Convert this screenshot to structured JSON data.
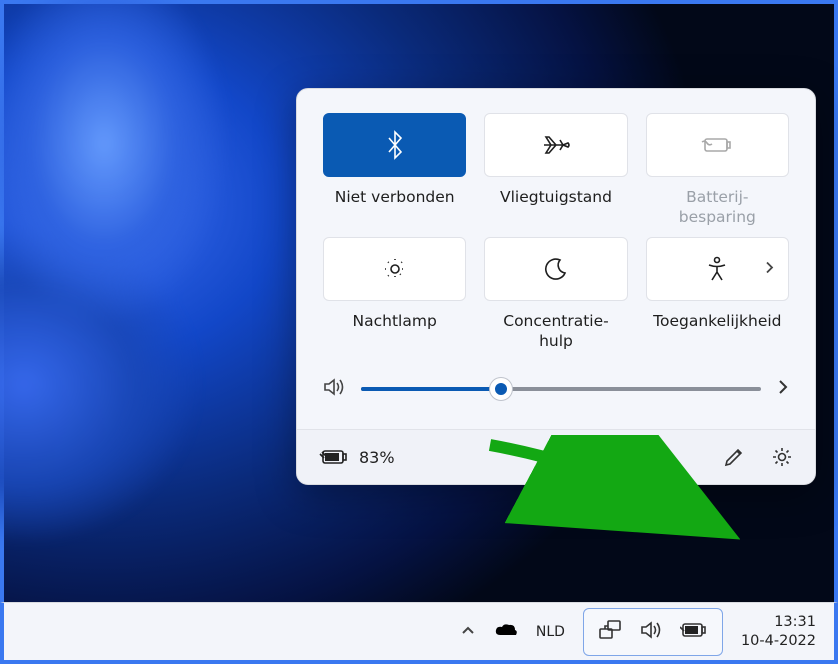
{
  "tiles": {
    "bluetooth": {
      "label": "Niet verbonden",
      "active": true
    },
    "airplane": {
      "label": "Vliegtuigstand"
    },
    "battery": {
      "label": "Batterij-\nbesparing",
      "disabled": true
    },
    "night": {
      "label": "Nachtlamp"
    },
    "focus": {
      "label": "Concentratie-\nhulp"
    },
    "access": {
      "label": "Toegankelijkheid"
    }
  },
  "volume_percent": 35,
  "battery_percent": "83%",
  "taskbar": {
    "language": "NLD",
    "time": "13:31",
    "date": "10-4-2022"
  }
}
